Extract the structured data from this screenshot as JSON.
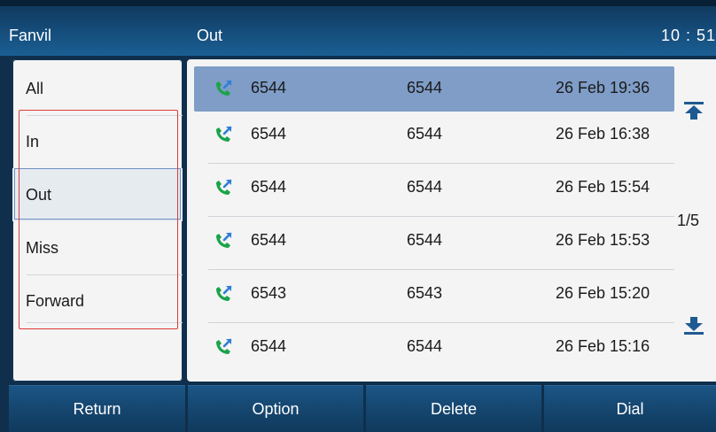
{
  "status_bar": {
    "brand": "Fanvil",
    "title": "Out",
    "clock": "10 : 51"
  },
  "filters": [
    {
      "label": "All",
      "selected": false
    },
    {
      "label": "In",
      "selected": false
    },
    {
      "label": "Out",
      "selected": true
    },
    {
      "label": "Miss",
      "selected": false
    },
    {
      "label": "Forward",
      "selected": false
    }
  ],
  "calls": [
    {
      "name": "6544",
      "number": "6544",
      "time": "26 Feb 19:36",
      "icon": "outgoing-call-icon",
      "highlighted": true
    },
    {
      "name": "6544",
      "number": "6544",
      "time": "26 Feb 16:38",
      "icon": "outgoing-call-icon",
      "highlighted": false
    },
    {
      "name": "6544",
      "number": "6544",
      "time": "26 Feb 15:54",
      "icon": "outgoing-call-icon",
      "highlighted": false
    },
    {
      "name": "6544",
      "number": "6544",
      "time": "26 Feb 15:53",
      "icon": "outgoing-call-icon",
      "highlighted": false
    },
    {
      "name": "6543",
      "number": "6543",
      "time": "26 Feb 15:20",
      "icon": "outgoing-call-icon",
      "highlighted": false
    },
    {
      "name": "6544",
      "number": "6544",
      "time": "26 Feb 15:16",
      "icon": "outgoing-call-icon",
      "highlighted": false
    }
  ],
  "pagination": {
    "indicator": "1/5"
  },
  "softkeys": [
    {
      "label": "Return"
    },
    {
      "label": "Option"
    },
    {
      "label": "Delete"
    },
    {
      "label": "Dial"
    }
  ],
  "colors": {
    "accent": "#7f9dc7",
    "call_icon_green": "#1aa34a",
    "call_icon_blue": "#2f7fd8",
    "annotation_red": "#e03a3a"
  }
}
